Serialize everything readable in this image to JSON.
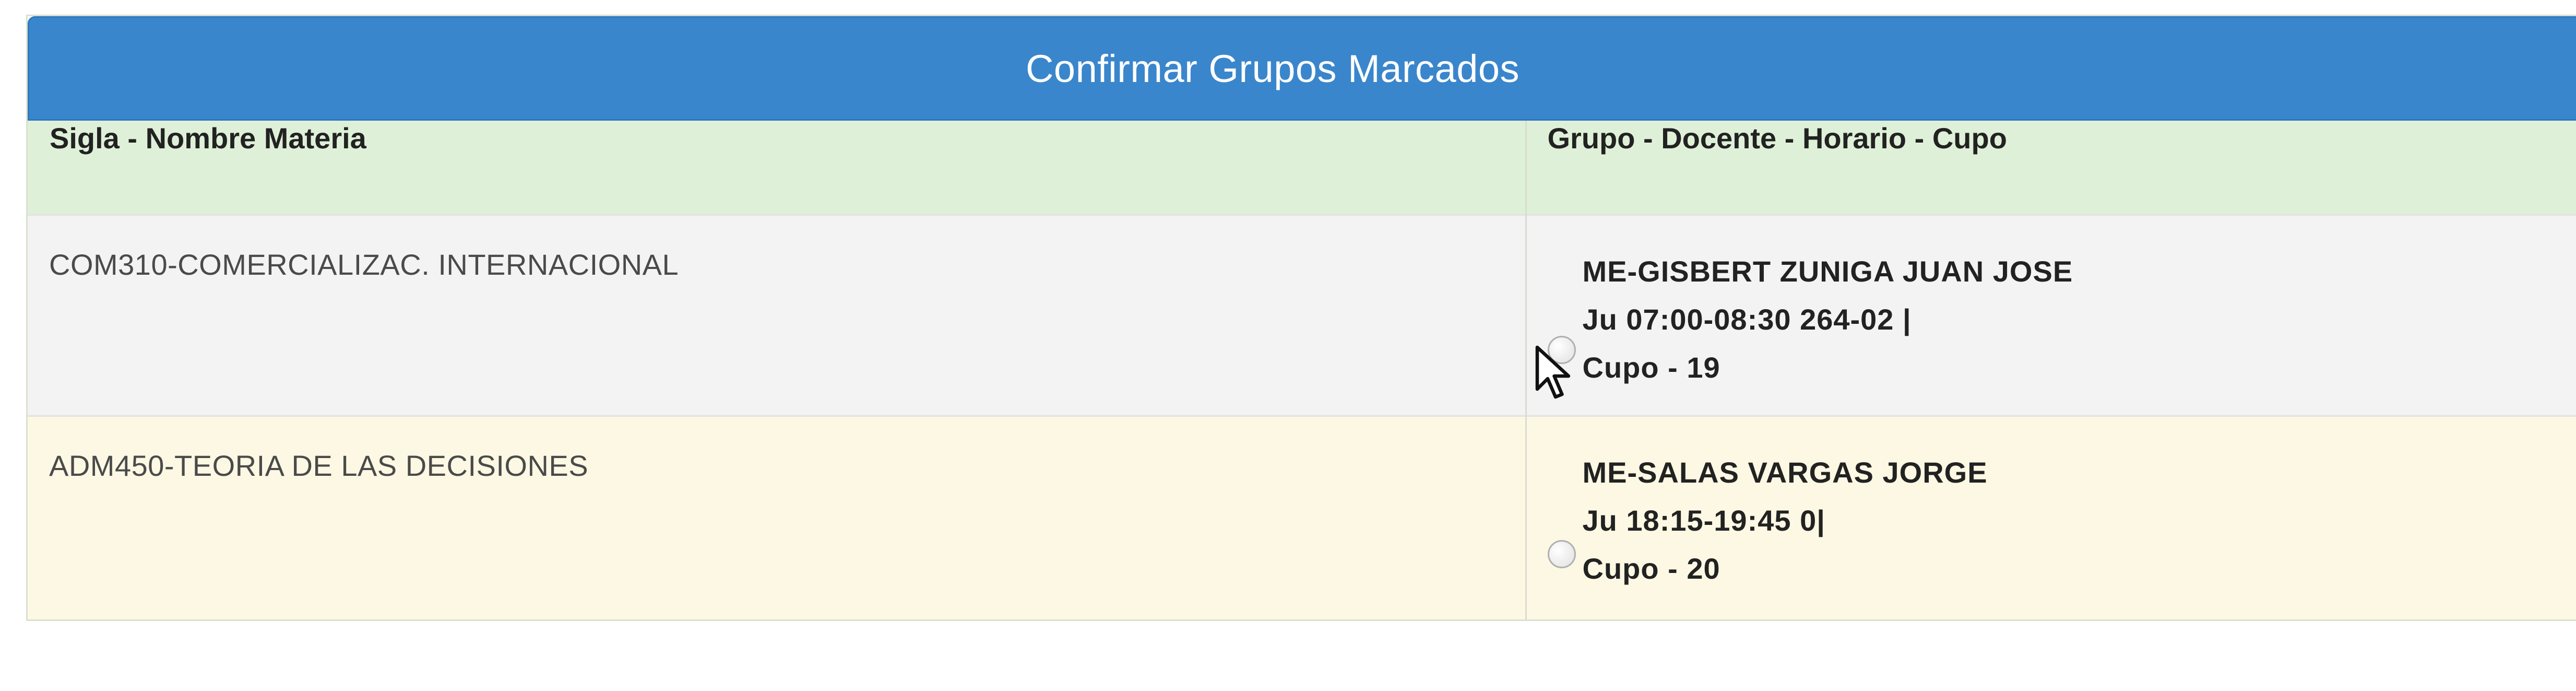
{
  "panel": {
    "title": "Confirmar Grupos Marcados"
  },
  "table": {
    "headers": {
      "subject": "Sigla - Nombre Materia",
      "group": "Grupo - Docente - Horario - Cupo"
    },
    "rows": [
      {
        "subject": "COM310-COMERCIALIZAC. INTERNACIONAL",
        "teacher": "ME-GISBERT ZUNIGA JUAN JOSE",
        "schedule": "Ju 07:00-08:30 264-02 |",
        "quota": "Cupo - 19",
        "selected": false
      },
      {
        "subject": "ADM450-TEORIA DE LAS DECISIONES",
        "teacher": "ME-SALAS VARGAS JORGE",
        "schedule": "Ju 18:15-19:45 0|",
        "quota": "Cupo - 20",
        "selected": false
      }
    ]
  },
  "colors": {
    "header_blue": "#3a86cc",
    "head_row_green": "#dff0d8",
    "row_grey": "#f3f3f3",
    "row_yellow": "#fcf8e3"
  },
  "icons": {
    "cursor": "mouse-pointer-icon"
  }
}
